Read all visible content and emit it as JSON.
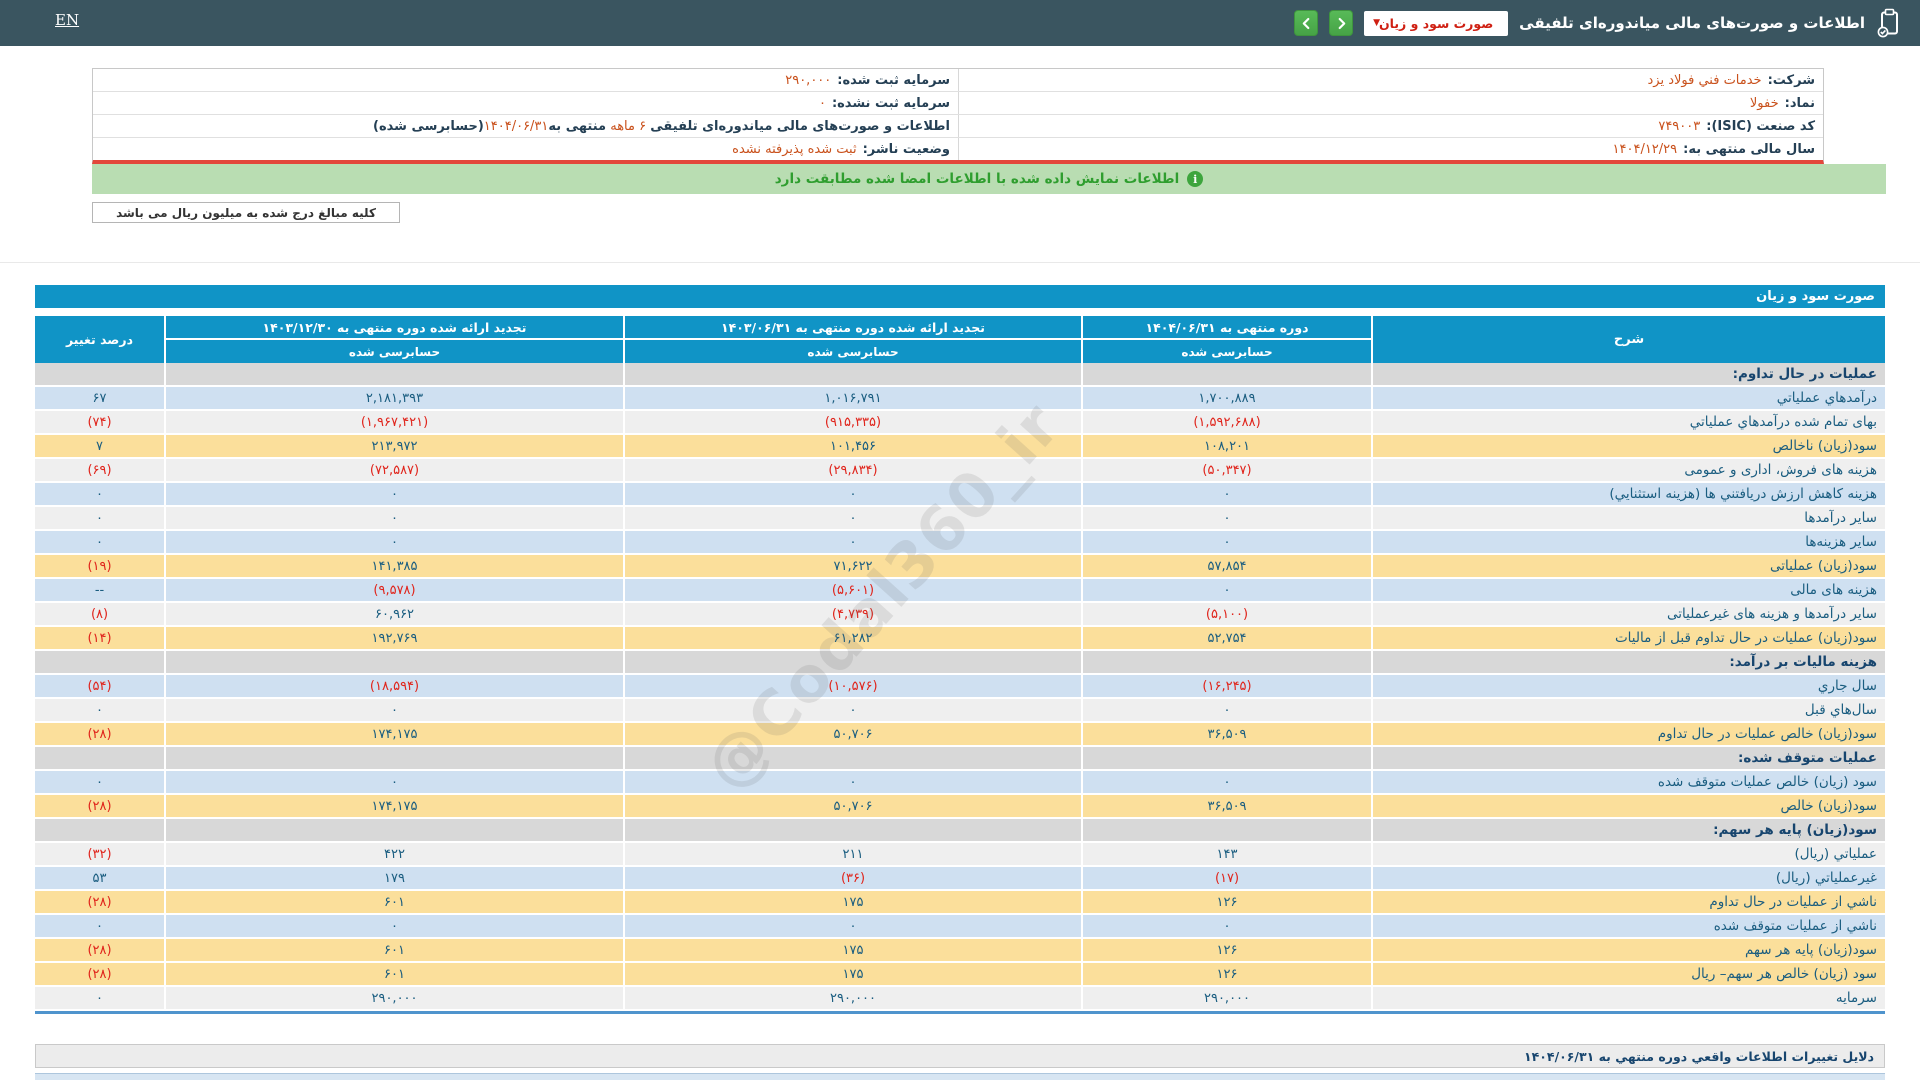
{
  "topbar": {
    "en_label": "EN",
    "title": "اطلاعات و صورت‌های مالی میاندوره‌ای تلفیقی",
    "dropdown_value": "صورت سود و زیان"
  },
  "info": {
    "rows": [
      {
        "right_label": "شرکت:",
        "right_value": "خدمات فني فولاد یزد",
        "left_label": "سرمایه ثبت شده:",
        "left_value": "۲۹۰,۰۰۰"
      },
      {
        "right_label": "نماد:",
        "right_value": "خفولا",
        "left_label": "سرمایه ثبت نشده:",
        "left_value": "۰"
      },
      {
        "right_label": "کد صنعت (ISIC):",
        "right_value": "۷۴۹۰۰۳",
        "left_parts": [
          "اطلاعات و صورت‌های مالی میاندوره‌ای تلفیقی",
          "۶ ماهه",
          "منتهی به",
          "۱۴۰۴/۰۶/۳۱",
          "(حسابرسی شده)"
        ]
      },
      {
        "right_label": "سال مالی منتهی به:",
        "right_value": "۱۴۰۴/۱۲/۲۹",
        "left_label": "وضعیت ناشر:",
        "left_value": "ثبت شده پذیرفته نشده"
      }
    ]
  },
  "notice": {
    "text": "اطلاعات نمایش داده شده با اطلاعات امضا شده مطابقت دارد"
  },
  "note": {
    "text": "کلیه مبالغ درج شده به میلیون ریال می باشد"
  },
  "table": {
    "title": "صورت سود و زیان",
    "columns": {
      "desc": "شرح",
      "p1": "دوره منتهی به ۱۴۰۴/۰۶/۳۱",
      "p2": "تجدید ارائه شده دوره منتهی به ۱۴۰۳/۰۶/۳۱",
      "p3": "تجدید ارائه شده دوره منتهی به ۱۴۰۳/۱۲/۳۰",
      "pct": "درصد تغییر",
      "audited": "حسابرسی شده"
    },
    "rows": [
      {
        "type": "section",
        "label": "عملیات در حال تداوم:"
      },
      {
        "type": "blue",
        "label": "درآمدهاي عملیاتي",
        "v1": "۱,۷۰۰,۸۸۹",
        "v2": "۱,۰۱۶,۷۹۱",
        "v3": "۲,۱۸۱,۳۹۳",
        "pct": "۶۷"
      },
      {
        "type": "gray",
        "label": "بهای تمام شده درآمدهاي عملیاتي",
        "v1": "(۱,۵۹۲,۶۸۸)",
        "v2": "(۹۱۵,۳۳۵)",
        "v3": "(۱,۹۶۷,۴۲۱)",
        "pct": "(۷۴)"
      },
      {
        "type": "yellow",
        "label": "سود(زیان) ناخالص",
        "v1": "۱۰۸,۲۰۱",
        "v2": "۱۰۱,۴۵۶",
        "v3": "۲۱۳,۹۷۲",
        "pct": "۷"
      },
      {
        "type": "gray",
        "label": "هزینه های فروش، اداری و عمومی",
        "v1": "(۵۰,۳۴۷)",
        "v2": "(۲۹,۸۳۴)",
        "v3": "(۷۲,۵۸۷)",
        "pct": "(۶۹)"
      },
      {
        "type": "blue",
        "label": "هزینه کاهش ارزش دریافتني ها (هزینه استثنایي)",
        "v1": "۰",
        "v2": "۰",
        "v3": "۰",
        "pct": "۰"
      },
      {
        "type": "gray",
        "label": "سایر درآمدها",
        "v1": "۰",
        "v2": "۰",
        "v3": "۰",
        "pct": "۰"
      },
      {
        "type": "blue",
        "label": "سایر هزینه‌ها",
        "v1": "۰",
        "v2": "۰",
        "v3": "۰",
        "pct": "۰"
      },
      {
        "type": "yellow",
        "label": "سود(زیان) عملیاتی",
        "v1": "۵۷,۸۵۴",
        "v2": "۷۱,۶۲۲",
        "v3": "۱۴۱,۳۸۵",
        "pct": "(۱۹)"
      },
      {
        "type": "blue",
        "label": "هزینه های مالی",
        "v1": "۰",
        "v2": "(۵,۶۰۱)",
        "v3": "(۹,۵۷۸)",
        "pct": "--"
      },
      {
        "type": "gray",
        "label": "سایر درآمدها و هزینه های غیرعملیاتی",
        "v1": "(۵,۱۰۰)",
        "v2": "(۴,۷۳۹)",
        "v3": "۶۰,۹۶۲",
        "pct": "(۸)"
      },
      {
        "type": "yellow",
        "label": "سود(زیان) عملیات در حال تداوم قبل از مالیات",
        "v1": "۵۲,۷۵۴",
        "v2": "۶۱,۲۸۲",
        "v3": "۱۹۲,۷۶۹",
        "pct": "(۱۴)"
      },
      {
        "type": "section",
        "label": "هزینه مالیات بر درآمد:"
      },
      {
        "type": "blue",
        "label": "سال جاري",
        "v1": "(۱۶,۲۴۵)",
        "v2": "(۱۰,۵۷۶)",
        "v3": "(۱۸,۵۹۴)",
        "pct": "(۵۴)"
      },
      {
        "type": "gray",
        "label": "سال‌هاي قبل",
        "v1": "۰",
        "v2": "۰",
        "v3": "۰",
        "pct": "۰"
      },
      {
        "type": "yellow",
        "label": "سود(زیان) خالص عملیات در حال تداوم",
        "v1": "۳۶,۵۰۹",
        "v2": "۵۰,۷۰۶",
        "v3": "۱۷۴,۱۷۵",
        "pct": "(۲۸)"
      },
      {
        "type": "section",
        "label": "عملیات متوقف شده:"
      },
      {
        "type": "blue",
        "label": "سود (زیان) خالص عملیات متوقف شده",
        "v1": "۰",
        "v2": "۰",
        "v3": "۰",
        "pct": "۰"
      },
      {
        "type": "yellow",
        "label": "سود(زیان) خالص",
        "v1": "۳۶,۵۰۹",
        "v2": "۵۰,۷۰۶",
        "v3": "۱۷۴,۱۷۵",
        "pct": "(۲۸)"
      },
      {
        "type": "section",
        "label": "سود(زیان) پایه هر سهم:"
      },
      {
        "type": "gray",
        "label": "عملیاتي (ریال)",
        "v1": "۱۴۳",
        "v2": "۲۱۱",
        "v3": "۴۲۲",
        "pct": "(۳۲)"
      },
      {
        "type": "blue",
        "label": "غیرعملیاتي (ریال)",
        "v1": "(۱۷)",
        "v2": "(۳۶)",
        "v3": "۱۷۹",
        "pct": "۵۳"
      },
      {
        "type": "yellow",
        "label": "ناشي از عملیات در حال تداوم",
        "v1": "۱۲۶",
        "v2": "۱۷۵",
        "v3": "۶۰۱",
        "pct": "(۲۸)"
      },
      {
        "type": "blue",
        "label": "ناشي از عملیات متوقف شده",
        "v1": "۰",
        "v2": "۰",
        "v3": "۰",
        "pct": "۰"
      },
      {
        "type": "yellow",
        "label": "سود(زیان) پایه هر سهم",
        "v1": "۱۲۶",
        "v2": "۱۷۵",
        "v3": "۶۰۱",
        "pct": "(۲۸)"
      },
      {
        "type": "yellow",
        "label": "سود (زیان) خالص هر سهم– ریال",
        "v1": "۱۲۶",
        "v2": "۱۷۵",
        "v3": "۶۰۱",
        "pct": "(۲۸)"
      },
      {
        "type": "gray",
        "label": "سرمایه",
        "v1": "۲۹۰,۰۰۰",
        "v2": "۲۹۰,۰۰۰",
        "v3": "۲۹۰,۰۰۰",
        "pct": "۰"
      }
    ]
  },
  "footer": {
    "reasons_title": "دلایل تغییرات اطلاعات واقعي دوره منتهي به ۱۴۰۴/۰۶/۳۱"
  },
  "watermark": "@Codal360_ir",
  "colors": {
    "topbar_bg": "#3a5560",
    "accent_blue": "#1094c6",
    "nav_green": "#4cae4c",
    "dropdown_text_red": "#cf1f12",
    "notice_bg": "#b9ddb2",
    "notice_text": "#2f9e2f",
    "divider_red": "#e3473b",
    "row_blue": "#cfe0f1",
    "row_gray": "#efefef",
    "row_yellow": "#fbdf9b",
    "row_section": "#d8d8d8",
    "value_navy": "#1a5d80",
    "negative_red": "#e0251c",
    "info_value_orange": "#c9511c"
  }
}
